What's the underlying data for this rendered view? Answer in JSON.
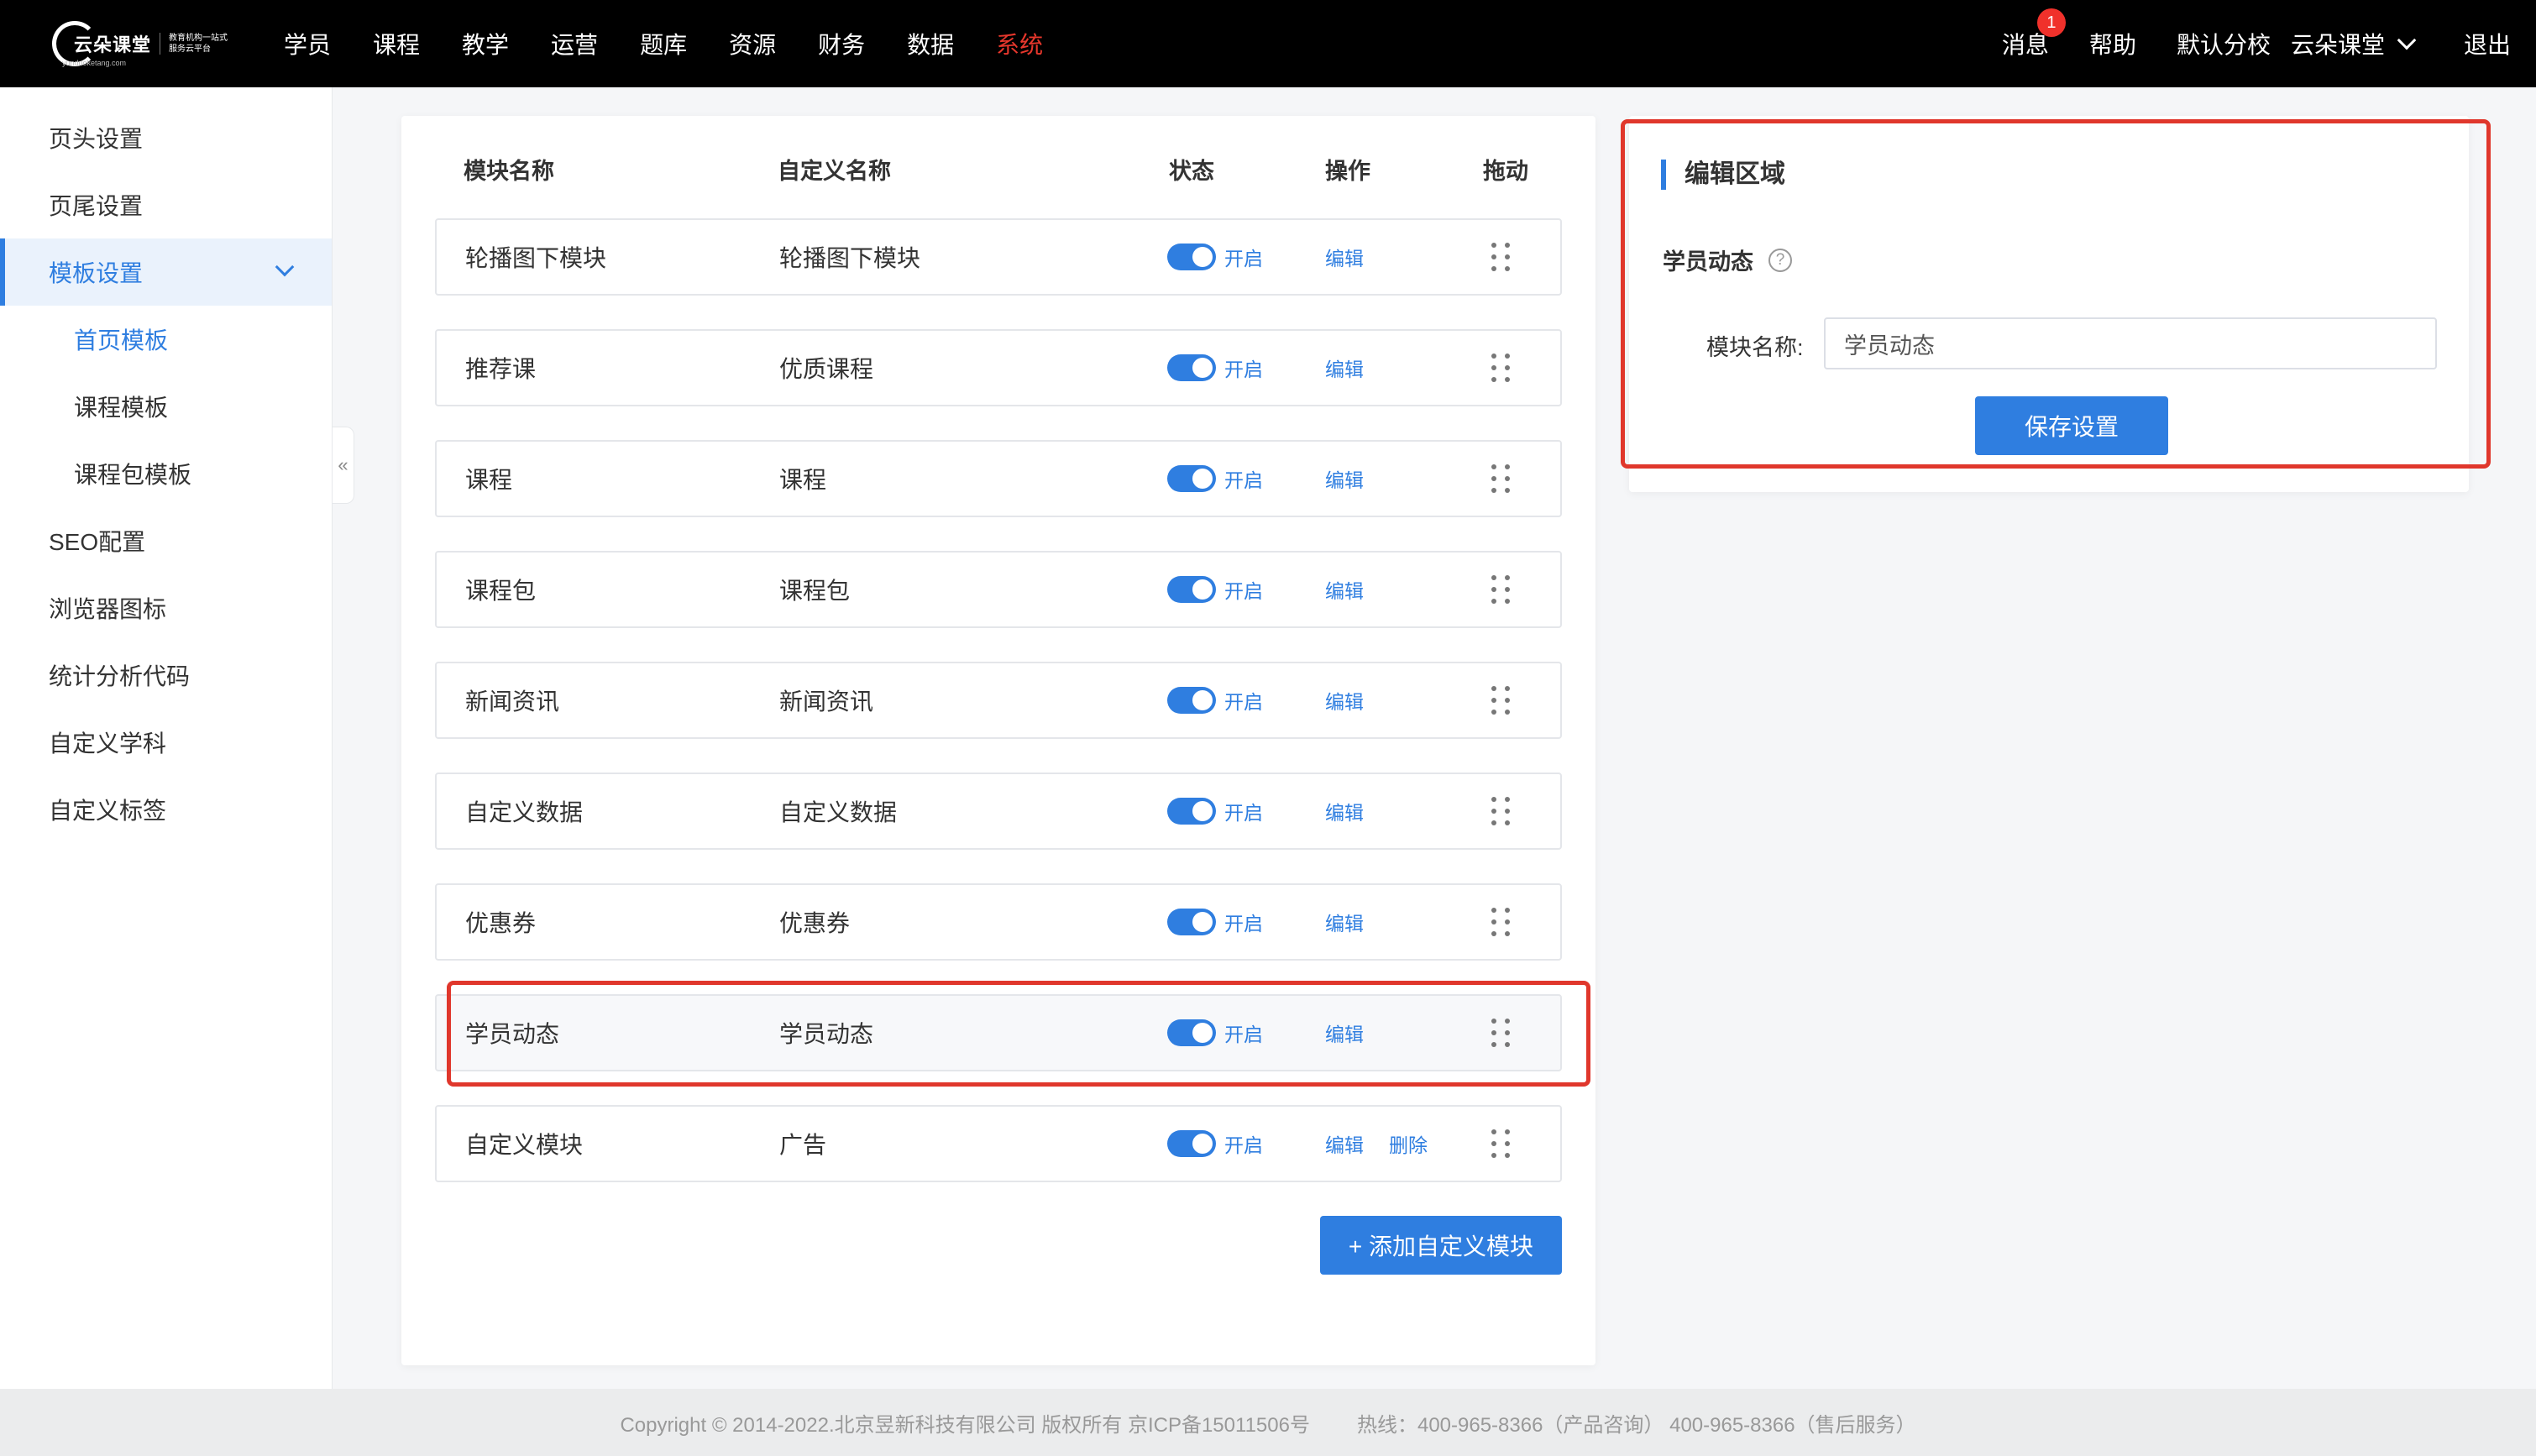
{
  "brand": {
    "logo_text": "云朵课堂",
    "tagline": "教育机构一站式服务云平台",
    "url": "yunduoketang.com"
  },
  "nav": [
    "学员",
    "课程",
    "教学",
    "运营",
    "题库",
    "资源",
    "财务",
    "数据",
    "系统"
  ],
  "top_right": {
    "messages": "消息",
    "badge": "1",
    "help": "帮助",
    "branch": "默认分校",
    "org": "云朵课堂",
    "logout": "退出"
  },
  "sidebar": {
    "items": [
      "页头设置",
      "页尾设置",
      "模板设置",
      "首页模板",
      "课程模板",
      "课程包模板",
      "SEO配置",
      "浏览器图标",
      "统计分析代码",
      "自定义学科",
      "自定义标签"
    ],
    "collapse": "«"
  },
  "table": {
    "headers": [
      "模块名称",
      "自定义名称",
      "状态",
      "操作",
      "拖动"
    ],
    "rows": [
      {
        "name": "轮播图下模块",
        "custom": "轮播图下模块",
        "status": "开启",
        "edit": "编辑",
        "delete": ""
      },
      {
        "name": "推荐课",
        "custom": "优质课程",
        "status": "开启",
        "edit": "编辑",
        "delete": ""
      },
      {
        "name": "课程",
        "custom": "课程",
        "status": "开启",
        "edit": "编辑",
        "delete": ""
      },
      {
        "name": "课程包",
        "custom": "课程包",
        "status": "开启",
        "edit": "编辑",
        "delete": ""
      },
      {
        "name": "新闻资讯",
        "custom": "新闻资讯",
        "status": "开启",
        "edit": "编辑",
        "delete": ""
      },
      {
        "name": "自定义数据",
        "custom": "自定义数据",
        "status": "开启",
        "edit": "编辑",
        "delete": ""
      },
      {
        "name": "优惠券",
        "custom": "优惠券",
        "status": "开启",
        "edit": "编辑",
        "delete": ""
      },
      {
        "name": "学员动态",
        "custom": "学员动态",
        "status": "开启",
        "edit": "编辑",
        "delete": ""
      },
      {
        "name": "自定义模块",
        "custom": "广告",
        "status": "开启",
        "edit": "编辑",
        "delete": "删除"
      }
    ],
    "add_button": "+ 添加自定义模块"
  },
  "edit_panel": {
    "title": "编辑区域",
    "module": "学员动态",
    "help": "?",
    "field_label": "模块名称:",
    "field_value": "学员动态",
    "save": "保存设置"
  },
  "footer": {
    "copyright": "Copyright © 2014-2022.北京昱新科技有限公司 版权所有 京ICP备15011506号",
    "hotline": "热线：400-965-8366（产品咨询） 400-965-8366（售后服务）"
  },
  "colors": {
    "accent": "#2f7ee0",
    "highlight": "#e0372c",
    "topbar": "#000000"
  }
}
